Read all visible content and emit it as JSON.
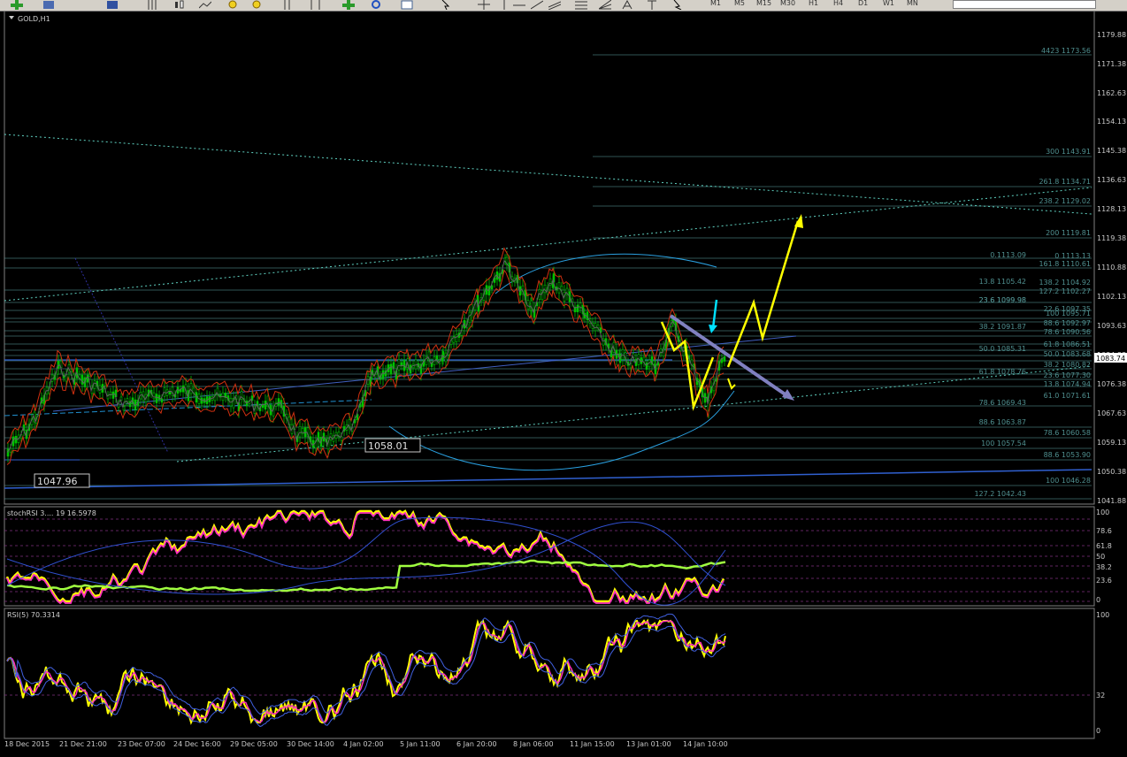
{
  "toolbar": {
    "timeframes": [
      "M1",
      "M5",
      "M15",
      "M30",
      "H1",
      "H4",
      "D1",
      "W1",
      "MN"
    ]
  },
  "main_chart": {
    "title": "GOLD,H1",
    "price_axis": [
      "1179.88",
      "1171.38",
      "1162.63",
      "1154.13",
      "1145.38",
      "1136.63",
      "1128.13",
      "1119.38",
      "1110.88",
      "1102.13",
      "1093.63",
      "1084.88",
      "1076.38",
      "1067.63",
      "1059.13",
      "1050.38",
      "1041.88"
    ],
    "current_price": "1083.74",
    "price_tags": [
      "1058.01",
      "1047.96"
    ],
    "fib_right": [
      "4423 1173.56",
      "300 1143.91",
      "261.8 1134.71",
      "238.2 1129.02",
      "200 1119.81",
      "0 1113.13",
      "161.8 1110.61",
      "138.2 1104.92",
      "127.2 1102.27",
      "23.6 1099.98",
      "22.6 1097.35",
      "100 1095.71",
      "88.6 1092.97",
      "78.6 1090.56",
      "61.8 1086.51",
      "50.0 1083.68",
      "38.2 1080.82",
      "23.6 1077.30",
      "13.8 1074.94",
      "61.0 1071.61",
      "78.6 1060.58",
      "88.6 1053.90",
      "100 1046.28",
      "127.2 1042.43"
    ],
    "fib_mid": [
      "0.1113.09",
      "13.8 1105.42",
      "23.6 1099.98",
      "38.2 1091.87",
      "50.0 1085.31",
      "61.8 1078.76",
      "78.6 1069.43",
      "88.6 1063.87",
      "100 1057.54"
    ]
  },
  "stoch_panel": {
    "title": "stochRSI 3.... 19 16.5978",
    "levels": [
      "100",
      "78.6",
      "61.8",
      "50",
      "38.2",
      "23.6",
      "0"
    ]
  },
  "rsi_panel": {
    "title": "RSI(5) 70.3314",
    "levels": [
      "100",
      "32",
      "0"
    ]
  },
  "time_axis": [
    "18 Dec 2015",
    "21 Dec 21:00",
    "23 Dec 07:00",
    "24 Dec 16:00",
    "29 Dec 05:00",
    "30 Dec 14:00",
    "4 Jan 02:00",
    "5 Jan 11:00",
    "6 Jan 20:00",
    "8 Jan 06:00",
    "11 Jan 15:00",
    "13 Jan 01:00",
    "14 Jan 10:00"
  ],
  "colors": {
    "background": "#000000",
    "candle_up": "#00c000",
    "fib_line": "#4f8f8f",
    "arrow_yellow": "#ffff00",
    "arrow_cyan": "#00e0ff",
    "arrow_slate": "#8080c0",
    "bollinger": "#2aa0e0",
    "band_red": "#d03010",
    "stoch_main": "#ff30c0",
    "stoch_signal": "#a0ff40"
  }
}
